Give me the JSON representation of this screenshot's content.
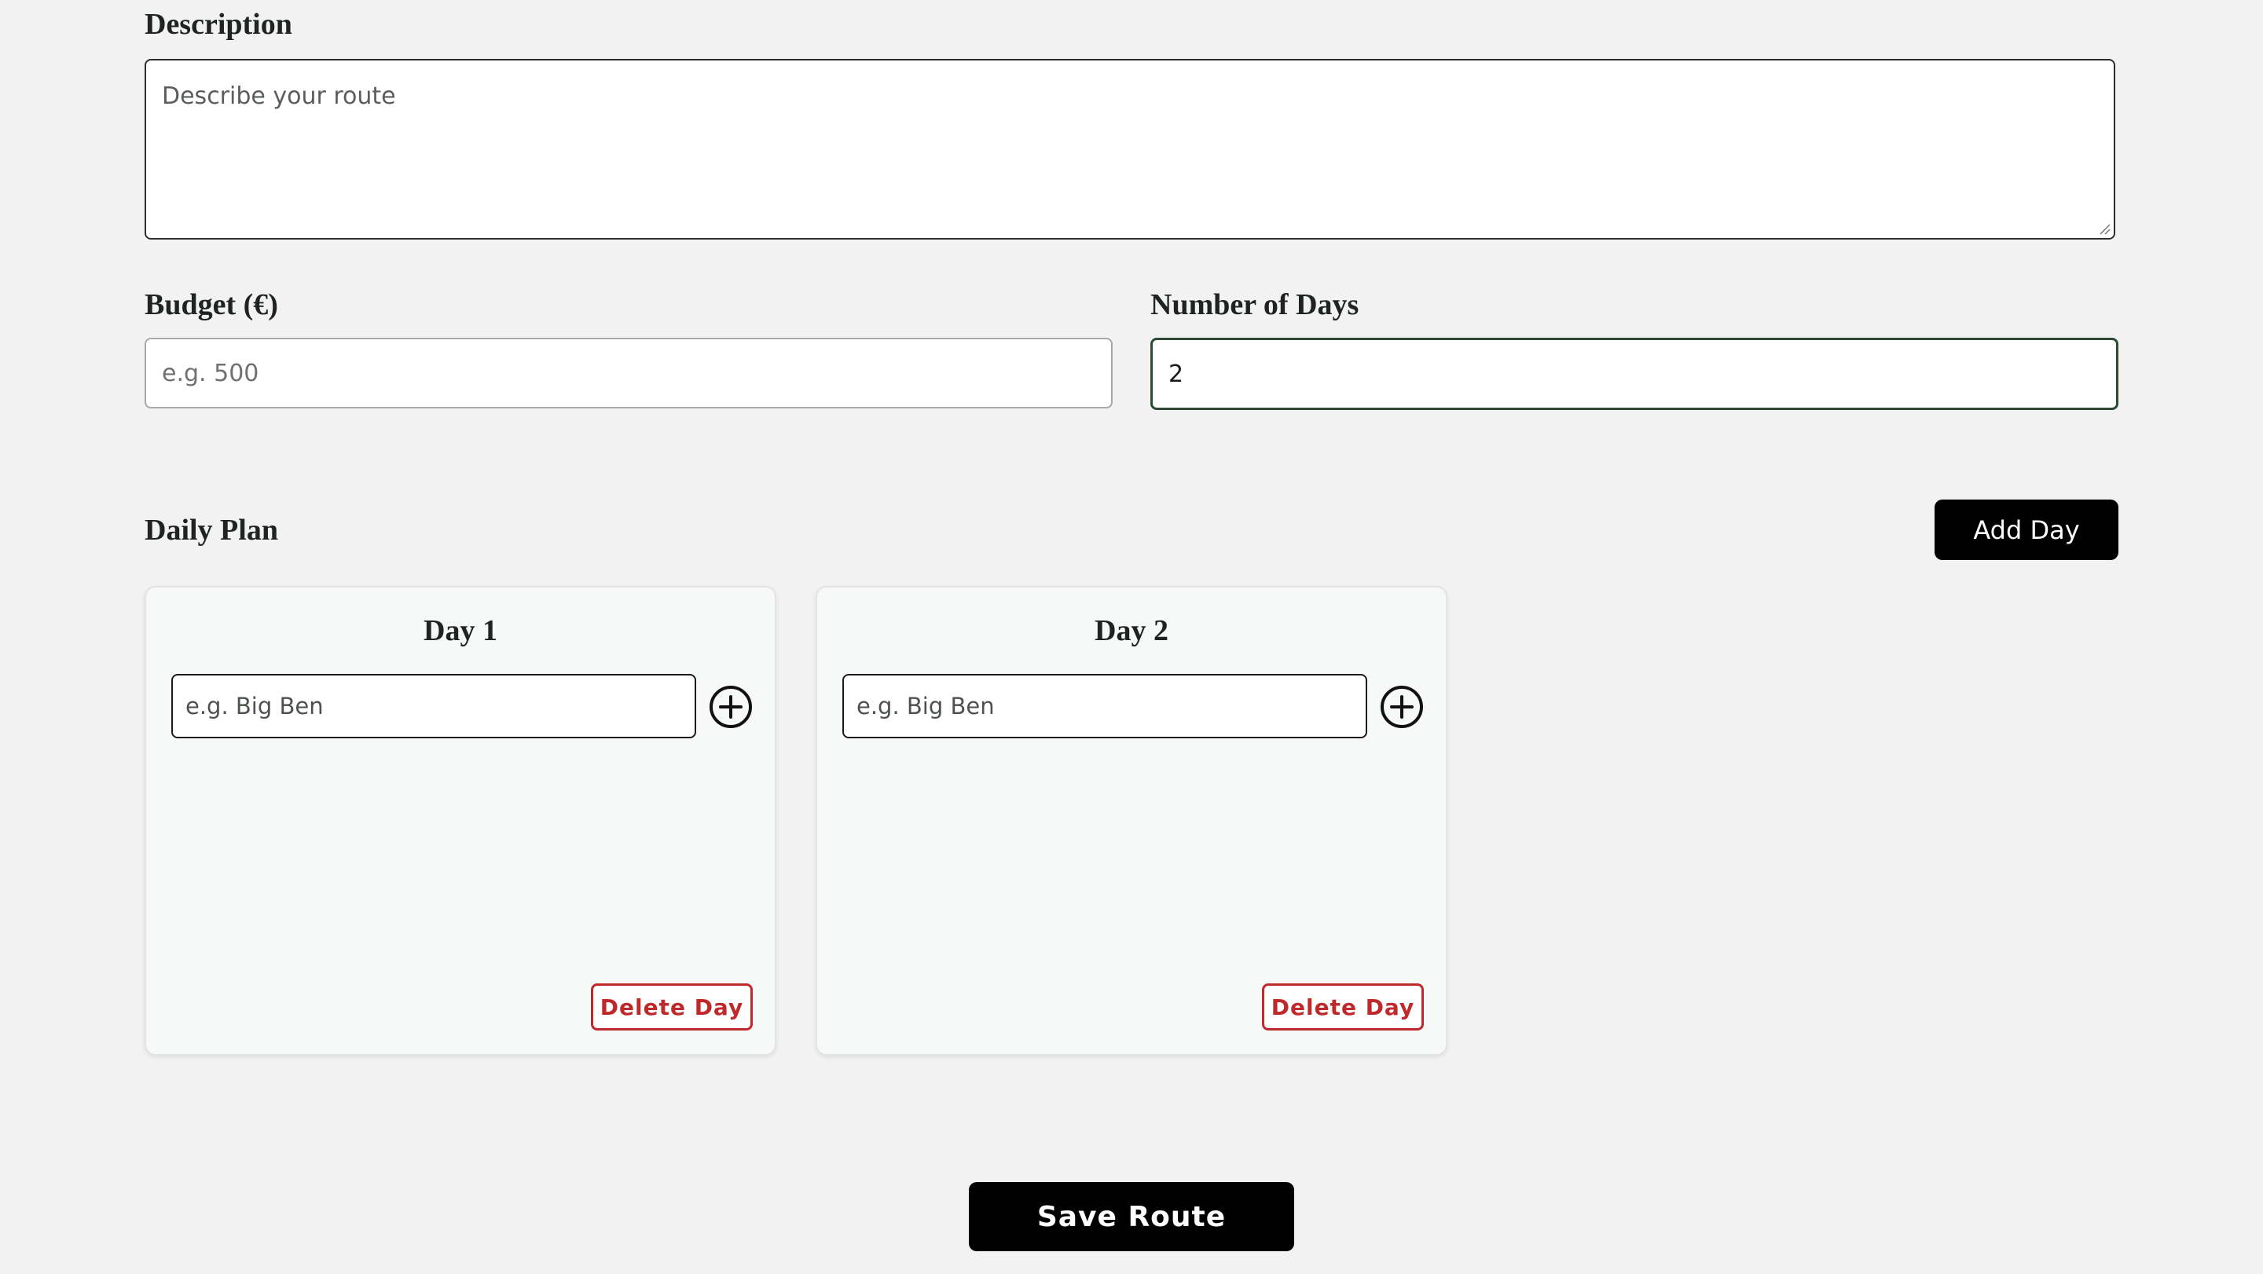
{
  "description": {
    "label": "Description",
    "placeholder": "Describe your route"
  },
  "budget": {
    "label": "Budget (€)",
    "placeholder": "e.g. 500"
  },
  "days": {
    "label": "Number of Days",
    "value": "2"
  },
  "daily_plan": {
    "title": "Daily Plan",
    "add_day_label": "Add Day",
    "cards": [
      {
        "title": "Day 1",
        "stop_placeholder": "e.g. Big Ben",
        "add_icon": "plus-circle-icon",
        "delete_label": "Delete Day"
      },
      {
        "title": "Day 2",
        "stop_placeholder": "e.g. Big Ben",
        "add_icon": "plus-circle-icon",
        "delete_label": "Delete Day"
      }
    ]
  },
  "save_label": "Save Route",
  "colors": {
    "background": "#f1f2f1",
    "primary_button": "#000000",
    "danger": "#c0292b",
    "focus_border": "#2f4a34"
  }
}
